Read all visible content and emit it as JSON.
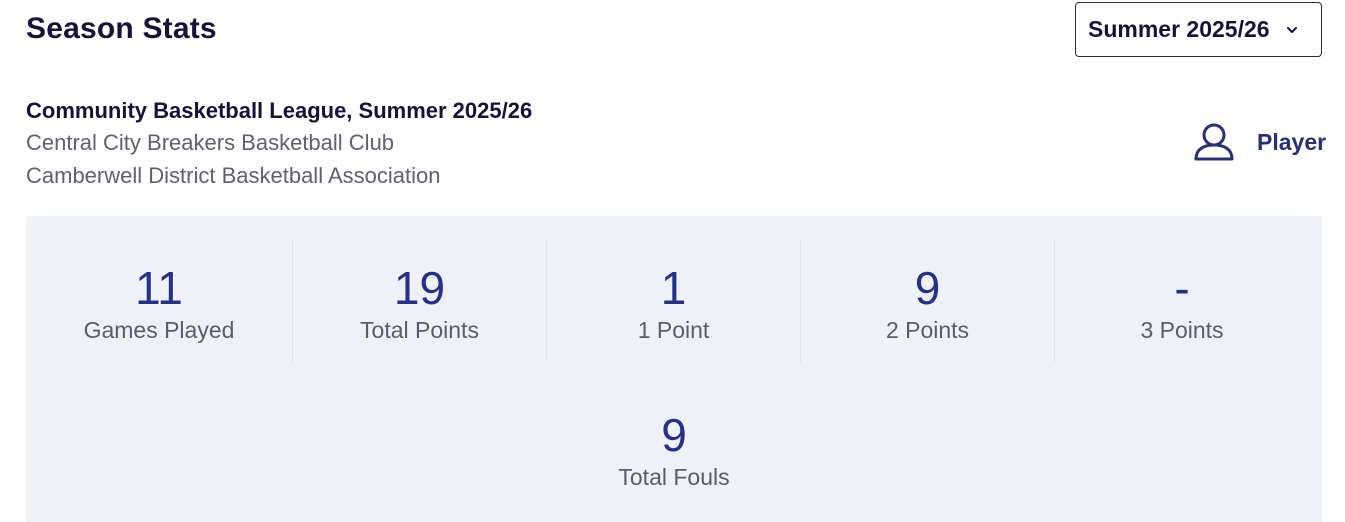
{
  "header": {
    "title": "Season Stats",
    "season_select": {
      "selected": "Summer 2025/26",
      "icon": "chevron-down-icon"
    }
  },
  "competition": {
    "league": "Community Basketball League, Summer 2025/26",
    "club": "Central City Breakers Basketball Club",
    "association": "Camberwell District Basketball Association"
  },
  "role": {
    "icon": "user-icon",
    "label": "Player"
  },
  "stats": [
    {
      "value": "11",
      "label": "Games Played"
    },
    {
      "value": "19",
      "label": "Total Points"
    },
    {
      "value": "1",
      "label": "1 Point"
    },
    {
      "value": "9",
      "label": "2 Points"
    },
    {
      "value": "-",
      "label": "3 Points"
    }
  ],
  "fouls": {
    "value": "9",
    "label": "Total Fouls"
  },
  "colors": {
    "accent": "#25307d",
    "stat_value": "#23318a",
    "panel_background": "#eef1f7",
    "muted_text": "#5f6070"
  }
}
